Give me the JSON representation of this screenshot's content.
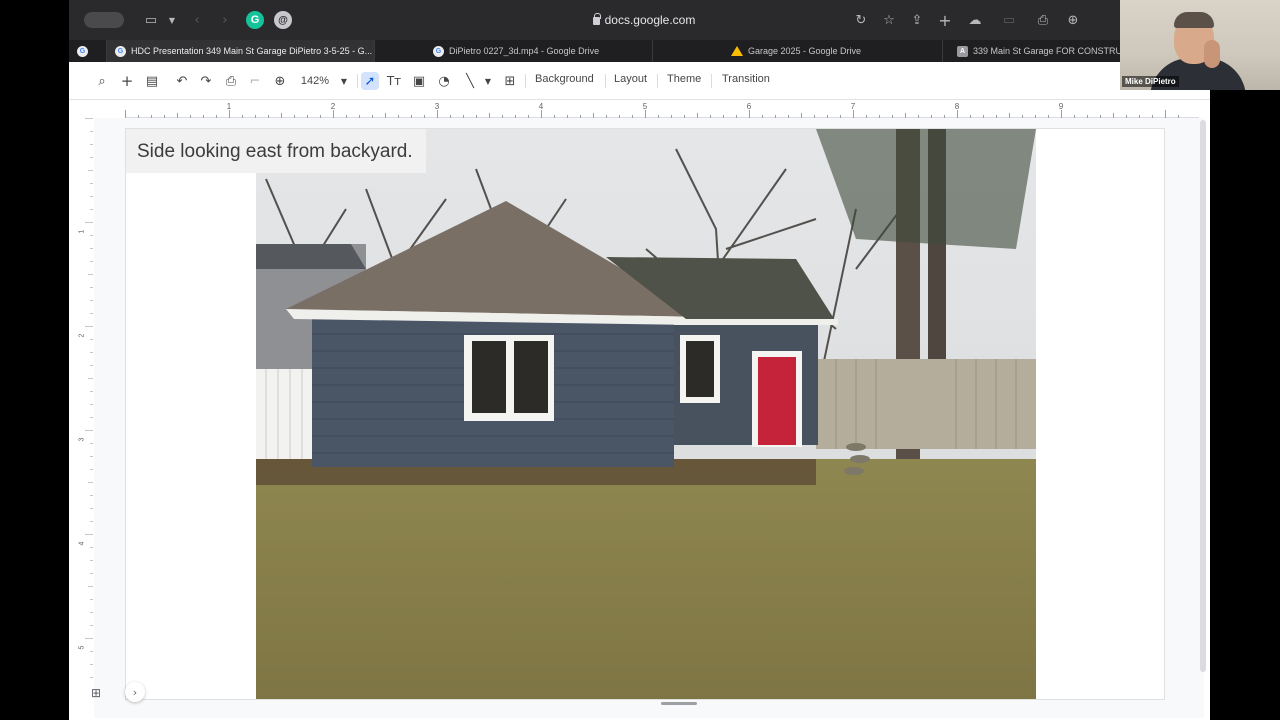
{
  "browser": {
    "url": "docs.google.com",
    "tabs": [
      {
        "label": "HDC Presentation 349 Main St Garage DiPietro 3-5-25 - G...",
        "favicon": "google-icon",
        "active": true
      },
      {
        "label": "DiPietro 0227_3d.mp4 - Google Drive",
        "favicon": "google-icon",
        "active": false
      },
      {
        "label": "Garage 2025 - Google Drive",
        "favicon": "drive-icon",
        "active": false
      },
      {
        "label": "339 Main St Garage FOR CONSTRUC",
        "favicon": "a-icon",
        "active": false
      }
    ]
  },
  "toolbar": {
    "zoom": "142%",
    "menus": [
      "Background",
      "Layout",
      "Theme",
      "Transition"
    ]
  },
  "ruler": {
    "horizontal": [
      "1",
      "2",
      "3",
      "4",
      "5",
      "6",
      "7",
      "8",
      "9"
    ],
    "vertical": [
      "1",
      "2",
      "3",
      "4",
      "5"
    ]
  },
  "slide": {
    "title": "Side looking east from backyard."
  },
  "video_call": {
    "participant_name": "Mike DiPietro"
  },
  "colors": {
    "door_red": "#c4233a",
    "siding": "#4a5566",
    "accent_blue": "#0b57d0"
  }
}
